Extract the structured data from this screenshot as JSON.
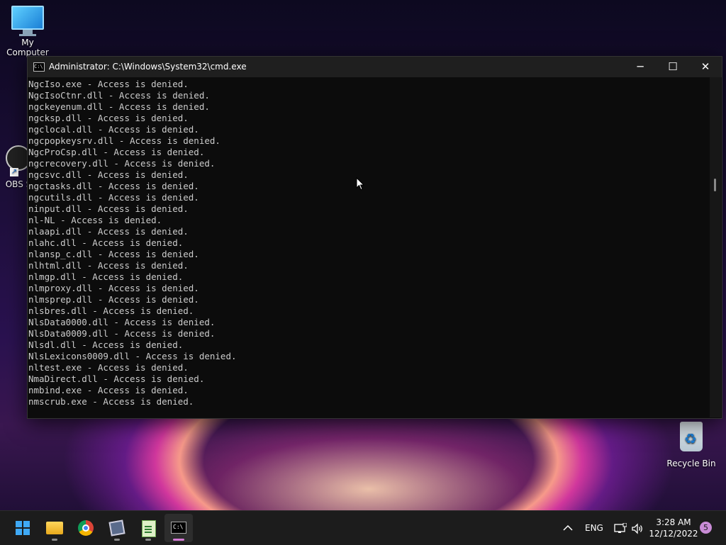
{
  "desktop": {
    "icons": [
      {
        "name": "my-computer",
        "label": "My Computer"
      },
      {
        "name": "obs",
        "label": "OBS S"
      },
      {
        "name": "recycle-bin",
        "label": "Recycle Bin"
      }
    ]
  },
  "window": {
    "title": "Administrator:  C:\\Windows\\System32\\cmd.exe",
    "icon": "cmd-icon",
    "controls": {
      "minimize": "─",
      "maximize": "☐",
      "close": "✕"
    }
  },
  "console": {
    "lines": [
      "NgcIso.exe - Access is denied.",
      "NgcIsoCtnr.dll - Access is denied.",
      "ngckeyenum.dll - Access is denied.",
      "ngcksp.dll - Access is denied.",
      "ngclocal.dll - Access is denied.",
      "ngcpopkeysrv.dll - Access is denied.",
      "NgcProCsp.dll - Access is denied.",
      "ngcrecovery.dll - Access is denied.",
      "ngcsvc.dll - Access is denied.",
      "ngctasks.dll - Access is denied.",
      "ngcutils.dll - Access is denied.",
      "ninput.dll - Access is denied.",
      "nl-NL - Access is denied.",
      "nlaapi.dll - Access is denied.",
      "nlahc.dll - Access is denied.",
      "nlansp_c.dll - Access is denied.",
      "nlhtml.dll - Access is denied.",
      "nlmgp.dll - Access is denied.",
      "nlmproxy.dll - Access is denied.",
      "nlmsprep.dll - Access is denied.",
      "nlsbres.dll - Access is denied.",
      "NlsData0000.dll - Access is denied.",
      "NlsData0009.dll - Access is denied.",
      "Nlsdl.dll - Access is denied.",
      "NlsLexicons0009.dll - Access is denied.",
      "nltest.exe - Access is denied.",
      "NmaDirect.dll - Access is denied.",
      "nmbind.exe - Access is denied.",
      "nmscrub.exe - Access is denied."
    ]
  },
  "taskbar": {
    "apps": [
      "start-icon",
      "file-explorer-icon",
      "chrome-icon",
      "video-editor-icon",
      "notepad-icon",
      "terminal-icon"
    ],
    "tray": {
      "chevron": "^",
      "language": "ENG",
      "time": "3:28 AM",
      "date": "12/12/2022",
      "notification_count": "5"
    }
  },
  "colors": {
    "console_bg": "#0c0c0c",
    "console_text": "#cccccc",
    "titlebar_bg": "#1f1f1f",
    "taskbar_bg": "#1c1c1c",
    "active_indicator": "#d57bd6"
  }
}
